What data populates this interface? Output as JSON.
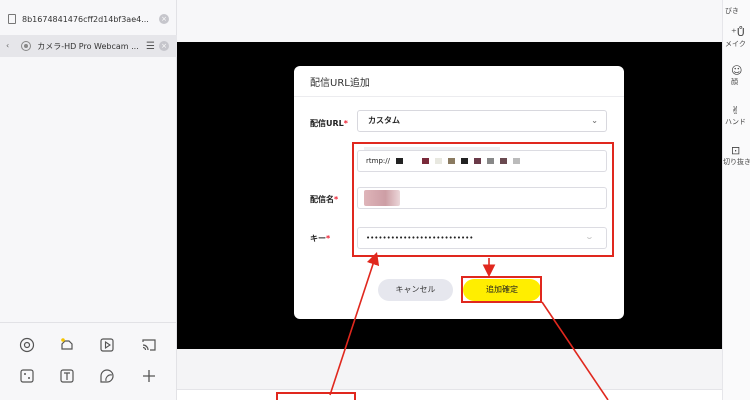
{
  "sources": [
    {
      "name": "8b1674841476cff2d14bf3ae4..."
    },
    {
      "name": "カメラ-HD Pro Webcam ..."
    }
  ],
  "right_tools": [
    {
      "label": "びき"
    },
    {
      "label": "メイク"
    },
    {
      "label": "顔"
    },
    {
      "label": "ハンド"
    },
    {
      "label": "切り抜き"
    }
  ],
  "dialog": {
    "title": "配信URL追加",
    "url_label": "配信URL",
    "url_select_value": "カスタム",
    "url_input_value": "rtmp://",
    "name_label": "配信名",
    "key_label": "キー",
    "key_value": "••••••••••••••••••••••••••",
    "cancel_label": "キャンセル",
    "confirm_label": "追加確定"
  },
  "colors": {
    "accent_yellow": "#ffee00",
    "annotation_red": "#e0281e"
  }
}
